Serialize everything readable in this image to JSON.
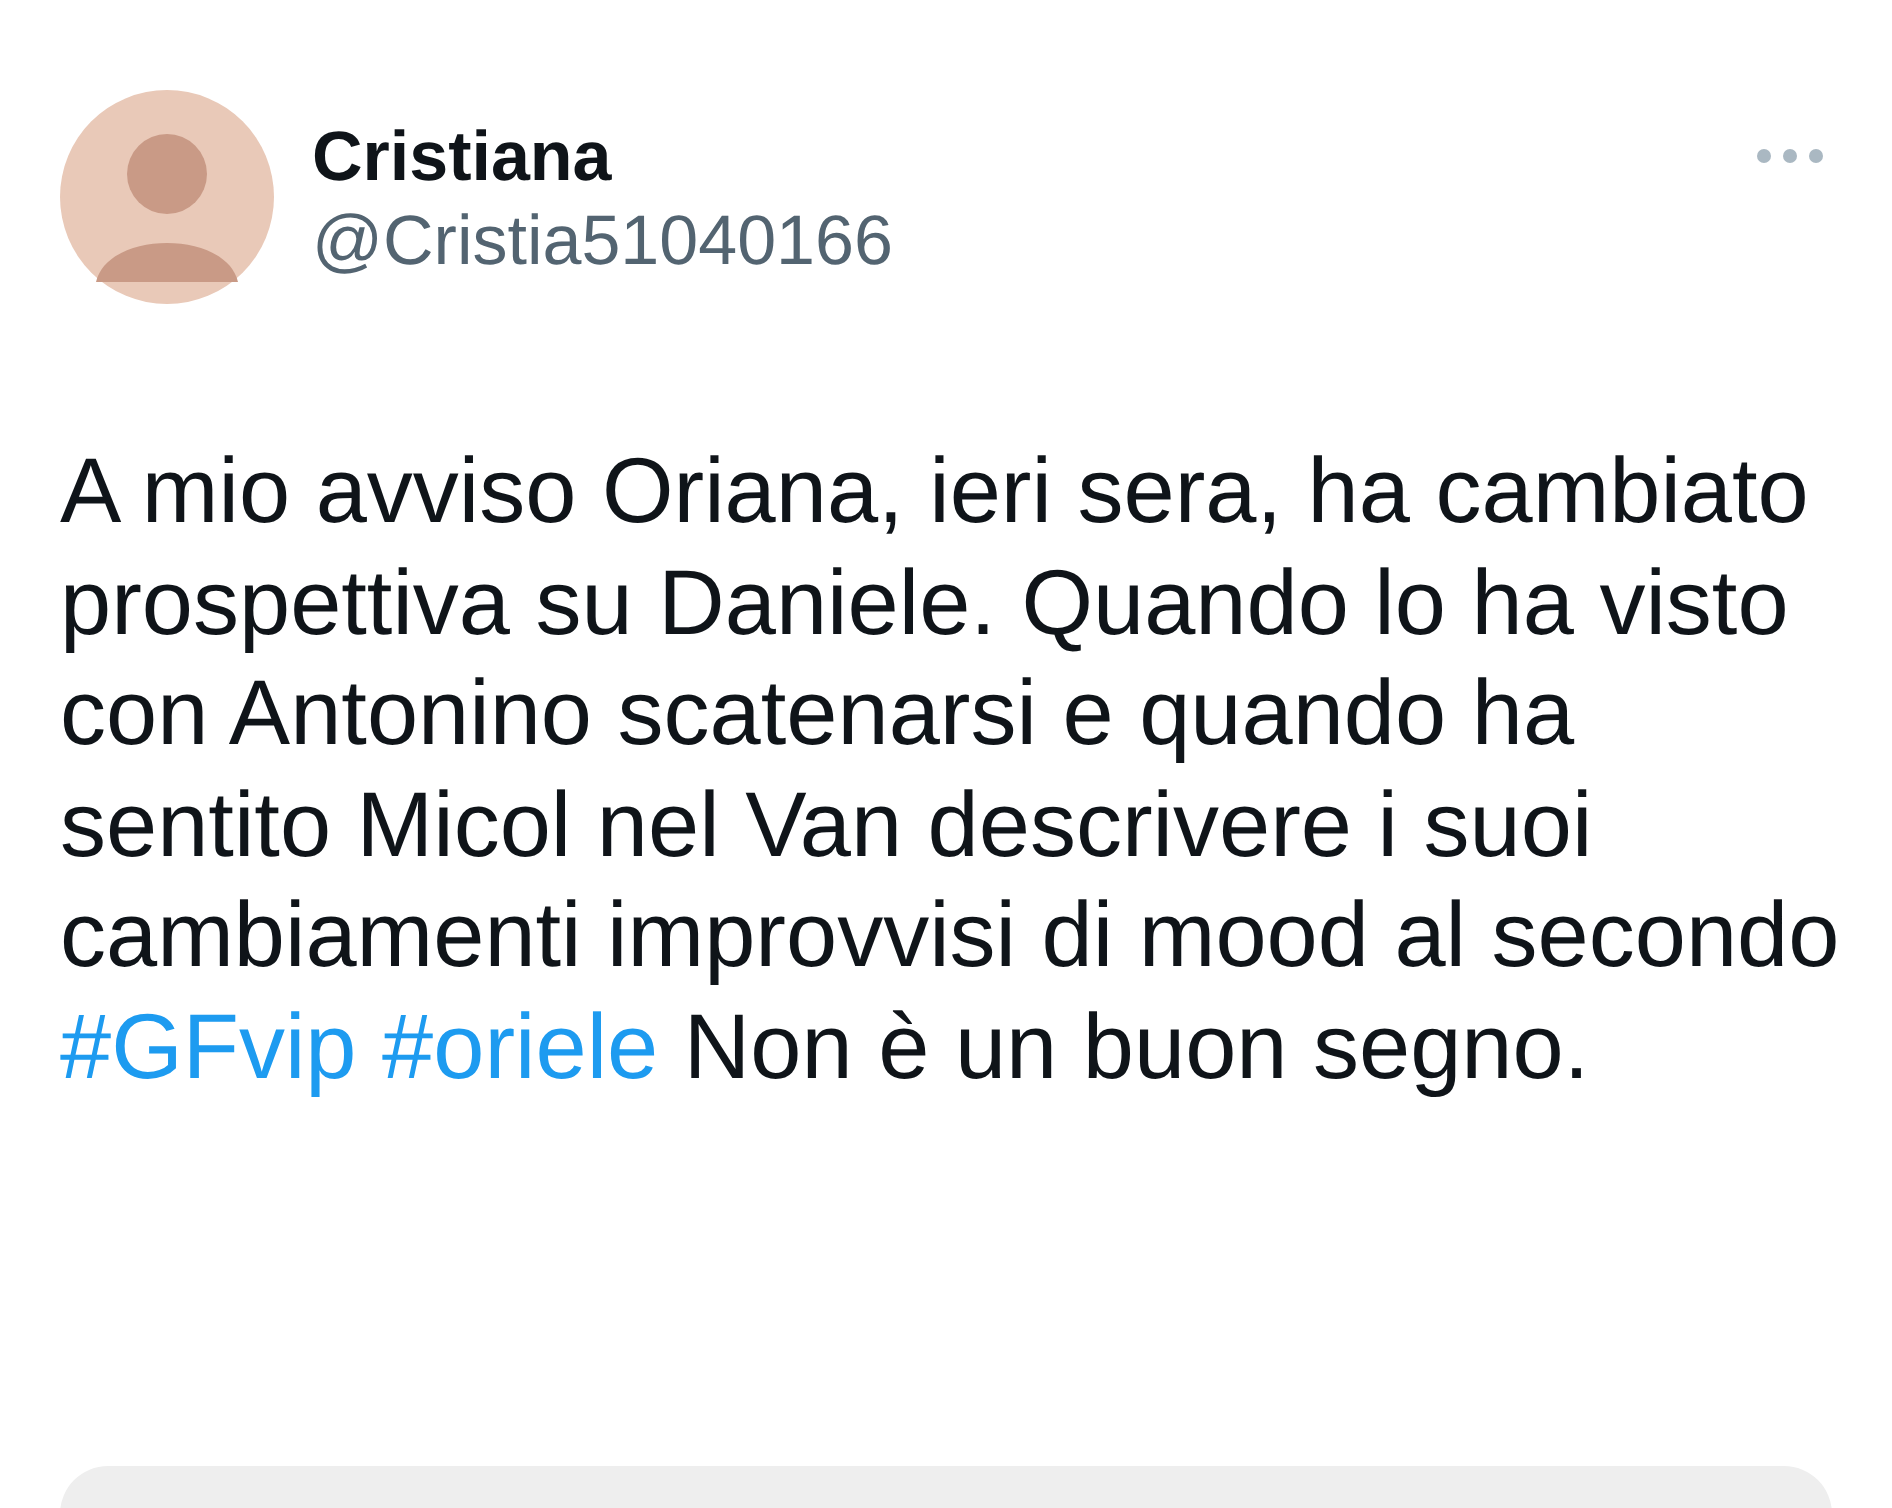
{
  "tweet": {
    "author": {
      "name": "Cristiana",
      "handle": "@Cristia51040166"
    },
    "text": [
      {
        "kind": "text",
        "text": "A mio avviso Oriana, ieri sera, ha cambiato prospettiva su Daniele. Quando lo ha visto con Antonino scatenarsi e quando ha sentito Micol nel Van descrivere i suoi cambiamenti improvvisi di mood al secondo "
      },
      {
        "kind": "hashtag",
        "text": "#GFvip"
      },
      {
        "kind": "hashtag",
        "text": "#oriele"
      },
      {
        "kind": "text",
        "text": " Non è un buon segno."
      }
    ]
  }
}
